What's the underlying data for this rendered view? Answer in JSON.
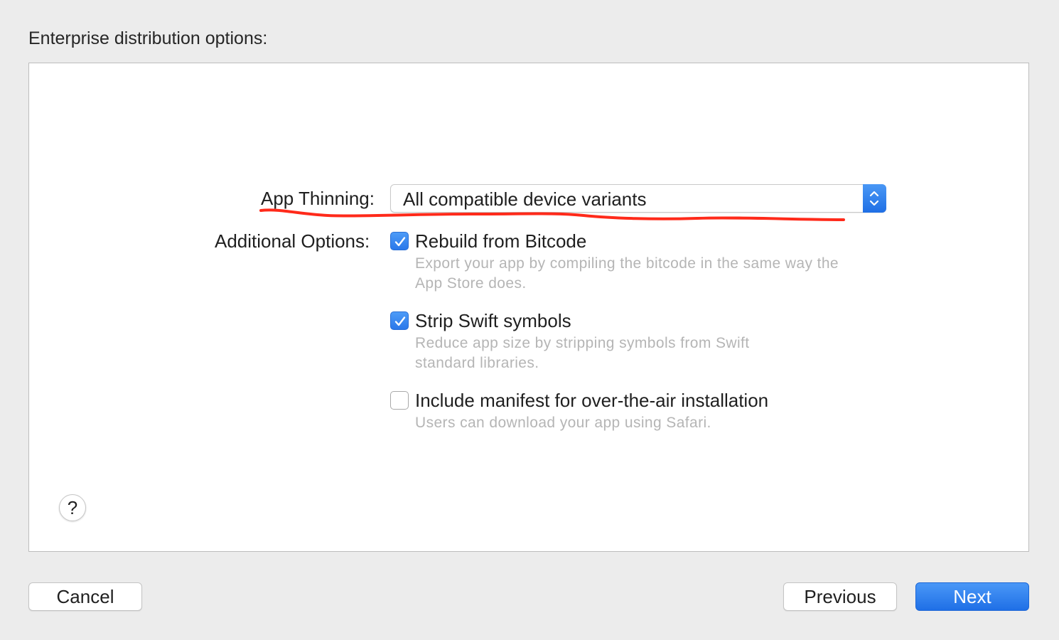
{
  "page": {
    "heading": "Enterprise distribution options:"
  },
  "app_thinning": {
    "label": "App Thinning:",
    "selected_value": "All compatible device variants"
  },
  "additional_options": {
    "label": "Additional Options:",
    "options": [
      {
        "label": "Rebuild from Bitcode",
        "checked": true,
        "description_lines": [
          "Export your app by compiling the bitcode in the same way the",
          "App Store does."
        ]
      },
      {
        "label": "Strip Swift symbols",
        "checked": true,
        "description_lines": [
          "Reduce app size by stripping symbols from Swift",
          "standard libraries."
        ]
      },
      {
        "label": "Include manifest for over-the-air installation",
        "checked": false,
        "description_lines": [
          "Users can download your app using Safari."
        ]
      }
    ]
  },
  "help": {
    "label": "?"
  },
  "buttons": {
    "cancel": "Cancel",
    "previous": "Previous",
    "next": "Next"
  },
  "colors": {
    "accent": "#1f6fe5",
    "annotation": "#ff2a1a",
    "description_text": "#b5b5b5",
    "window_background": "#ececec"
  }
}
